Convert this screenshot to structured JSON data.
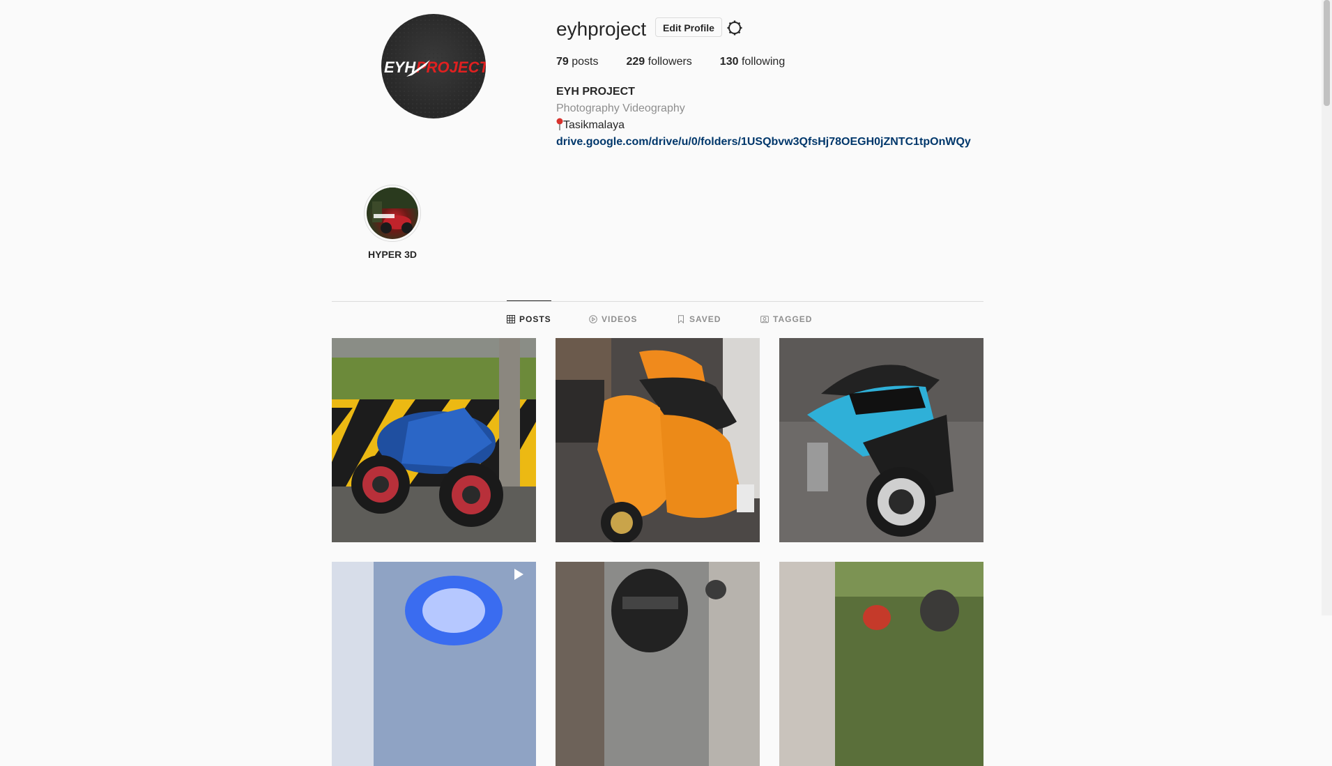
{
  "profile": {
    "username": "eyhproject",
    "edit_profile_label": "Edit Profile",
    "avatar_text": "EYHPROJECT",
    "posts_count": "79",
    "posts_label": "posts",
    "followers_count": "229",
    "followers_label": "followers",
    "following_count": "130",
    "following_label": "following",
    "full_name": "EYH PROJECT",
    "category": "Photography Videography",
    "location": "Tasikmalaya",
    "link": "drive.google.com/drive/u/0/folders/1USQbvw3QfsHj78OEGH0jZNTC1tpOnWQy"
  },
  "highlights": [
    {
      "label": "HYPER 3D"
    }
  ],
  "tabs": [
    {
      "label": "POSTS",
      "icon": "grid-icon",
      "active": true
    },
    {
      "label": "VIDEOS",
      "icon": "play-circle-icon",
      "active": false
    },
    {
      "label": "SAVED",
      "icon": "bookmark-icon",
      "active": false
    },
    {
      "label": "TAGGED",
      "icon": "tagged-icon",
      "active": false
    }
  ],
  "posts": [
    {
      "subject": "blue sport motorcycle",
      "type": "image"
    },
    {
      "subject": "orange scooter",
      "type": "image"
    },
    {
      "subject": "cyan scooter",
      "type": "image"
    },
    {
      "subject": "neon light",
      "type": "video"
    },
    {
      "subject": "rider with helmet",
      "type": "image"
    },
    {
      "subject": "rider in forest",
      "type": "image"
    }
  ],
  "colors": {
    "background": "#fafafa",
    "text": "#262626",
    "muted": "#8e8e8e",
    "link": "#00376b",
    "border": "#dbdbdb"
  }
}
